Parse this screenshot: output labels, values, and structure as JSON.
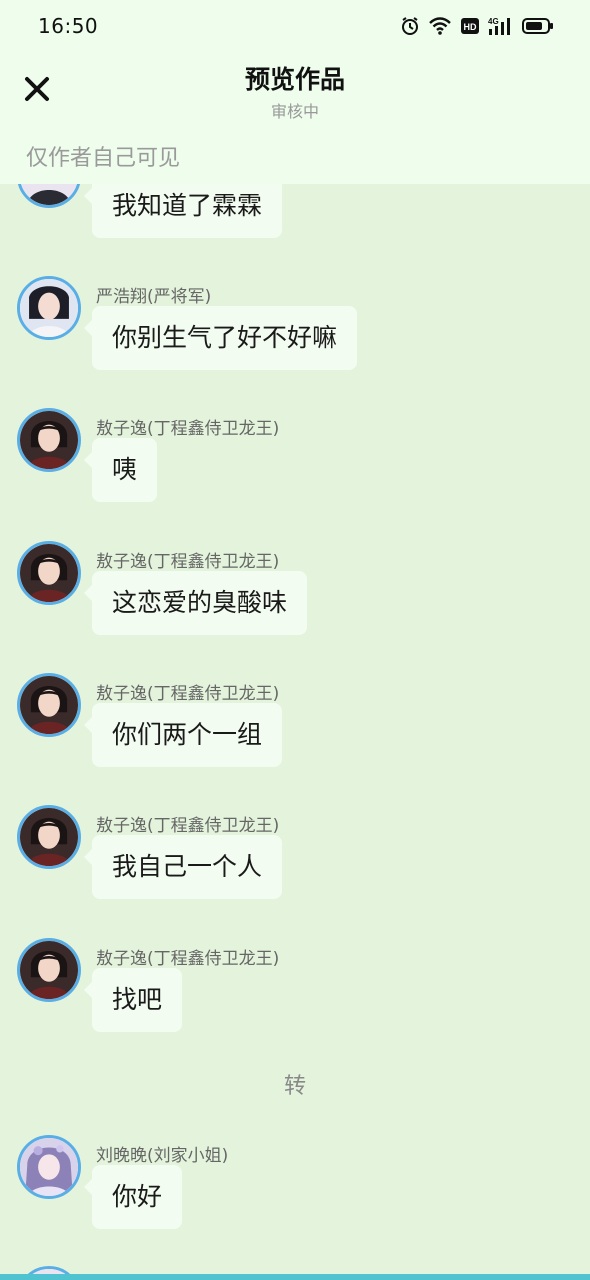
{
  "status_bar": {
    "time": "16:50",
    "icons": [
      "alarm-icon",
      "wifi-icon",
      "hd-icon",
      "signal-4g-icon",
      "battery-icon"
    ]
  },
  "header": {
    "title": "预览作品",
    "subtitle": "审核中",
    "close_icon": "close-icon",
    "visibility_note": "仅作者自己可见"
  },
  "colors": {
    "header_bg": "#eefdec",
    "chat_bg": "#e4f4dc",
    "bubble_bg": "#f3fcf0",
    "avatar_ring": "#5aaee6"
  },
  "messages": [
    {
      "sender": "",
      "text": "我知道了霖霖",
      "avatar": "partial-avatar"
    },
    {
      "sender": "严浩翔(严将军)",
      "text": "你别生气了好不好嘛",
      "avatar": "yan-avatar"
    },
    {
      "sender": "敖子逸(丁程鑫侍卫龙王)",
      "text": "咦",
      "avatar": "ao-avatar"
    },
    {
      "sender": "敖子逸(丁程鑫侍卫龙王)",
      "text": "这恋爱的臭酸味",
      "avatar": "ao-avatar"
    },
    {
      "sender": "敖子逸(丁程鑫侍卫龙王)",
      "text": "你们两个一组",
      "avatar": "ao-avatar"
    },
    {
      "sender": "敖子逸(丁程鑫侍卫龙王)",
      "text": "我自己一个人",
      "avatar": "ao-avatar"
    },
    {
      "sender": "敖子逸(丁程鑫侍卫龙王)",
      "text": "找吧",
      "avatar": "ao-avatar"
    }
  ],
  "divider": "转",
  "after_divider": [
    {
      "sender": "刘晚晚(刘家小姐)",
      "text": "你好",
      "avatar": "liu-avatar"
    }
  ]
}
